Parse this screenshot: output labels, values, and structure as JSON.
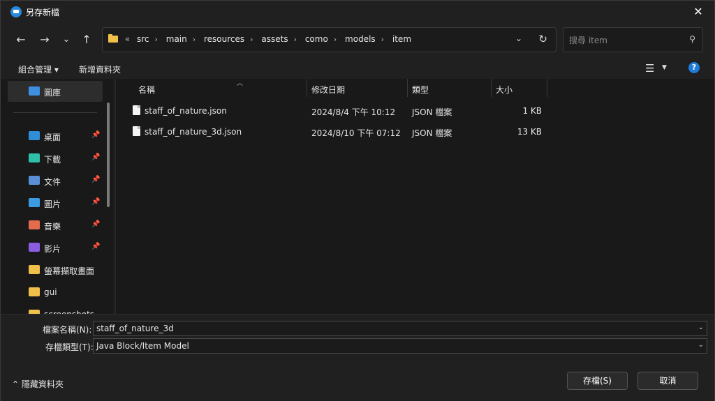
{
  "window": {
    "title": "另存新檔",
    "close": "✕"
  },
  "nav": {
    "back": "←",
    "forward": "→",
    "recent": "⌄",
    "up": "↑",
    "breadcrumb": [
      "src",
      "main",
      "resources",
      "assets",
      "como",
      "models",
      "item"
    ],
    "breadcrumb_lead": "«",
    "search_placeholder": "搜尋 item"
  },
  "toolbar": {
    "organize": "組合管理 ▾",
    "new_folder": "新增資料夾",
    "help": "?"
  },
  "sidebar": {
    "items": [
      {
        "label": "圖庫",
        "icon": "gallery-icon",
        "color": "#3d8fe0",
        "pinned": false
      },
      {
        "label": "桌面",
        "icon": "desktop-icon",
        "color": "#2f8fd6",
        "pinned": true
      },
      {
        "label": "下載",
        "icon": "download-icon",
        "color": "#2fc0a8",
        "pinned": true
      },
      {
        "label": "文件",
        "icon": "document-icon",
        "color": "#5a8fd6",
        "pinned": true
      },
      {
        "label": "圖片",
        "icon": "pictures-icon",
        "color": "#3d9be0",
        "pinned": true
      },
      {
        "label": "音樂",
        "icon": "music-icon",
        "color": "#e56b4f",
        "pinned": true
      },
      {
        "label": "影片",
        "icon": "video-icon",
        "color": "#8a5de0",
        "pinned": true
      },
      {
        "label": "螢幕擷取畫面",
        "icon": "folder-icon",
        "color": "#f0c04a",
        "pinned": false
      },
      {
        "label": "gui",
        "icon": "folder-icon",
        "color": "#f0c04a",
        "pinned": false
      },
      {
        "label": "screenshots",
        "icon": "folder-icon",
        "color": "#f0c04a",
        "pinned": false
      }
    ]
  },
  "columns": {
    "name": "名稱",
    "date": "修改日期",
    "type": "類型",
    "size": "大小"
  },
  "files": [
    {
      "name": "staff_of_nature.json",
      "date": "2024/8/4 下午 10:12",
      "type": "JSON 檔案",
      "size": "1 KB"
    },
    {
      "name": "staff_of_nature_3d.json",
      "date": "2024/8/10 下午 07:12",
      "type": "JSON 檔案",
      "size": "13 KB"
    }
  ],
  "form": {
    "filename_label": "檔案名稱(N):",
    "filename_value": "staff_of_nature_3d",
    "filetype_label": "存檔類型(T):",
    "filetype_value": "Java Block/Item Model"
  },
  "footer": {
    "hide_folders": "隱藏資料夾",
    "save": "存檔(S)",
    "cancel": "取消"
  }
}
